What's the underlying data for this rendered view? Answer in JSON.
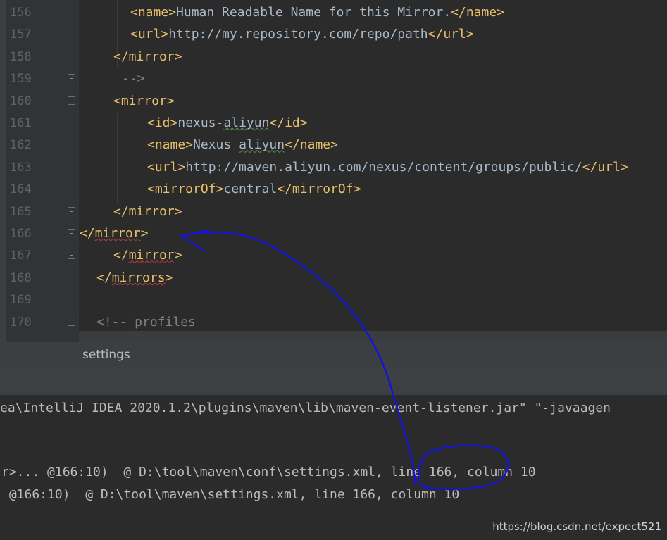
{
  "editor": {
    "lines": [
      {
        "num": "156",
        "indent": 185,
        "segments": [
          {
            "c": "tag",
            "t": "<name>"
          },
          {
            "c": "txt",
            "t": "Human Readable Name for this Mirror."
          },
          {
            "c": "tag",
            "t": "</name>"
          }
        ]
      },
      {
        "num": "157",
        "indent": 185,
        "segments": [
          {
            "c": "tag",
            "t": "<url>"
          },
          {
            "c": "link",
            "t": "http://my.repository.com/repo/path"
          },
          {
            "c": "tag",
            "t": "</url>"
          }
        ]
      },
      {
        "num": "158",
        "indent": 161,
        "segments": [
          {
            "c": "tag",
            "t": "</mirror>"
          }
        ]
      },
      {
        "num": "159",
        "indent": 173,
        "fold": true,
        "segments": [
          {
            "c": "cmt",
            "t": "-->"
          }
        ]
      },
      {
        "num": "160",
        "indent": 161,
        "fold": true,
        "segments": [
          {
            "c": "tag",
            "t": "<mirror>"
          }
        ]
      },
      {
        "num": "161",
        "indent": 209,
        "segments": [
          {
            "c": "tag",
            "t": "<id>"
          },
          {
            "c": "txt",
            "t": "nexus-"
          },
          {
            "c": "txt warn",
            "t": "aliyun"
          },
          {
            "c": "tag",
            "t": "</id>"
          }
        ]
      },
      {
        "num": "162",
        "indent": 209,
        "segments": [
          {
            "c": "tag",
            "t": "<name>"
          },
          {
            "c": "txt",
            "t": "Nexus "
          },
          {
            "c": "txt warn",
            "t": "aliyun"
          },
          {
            "c": "tag",
            "t": "</name>"
          }
        ]
      },
      {
        "num": "163",
        "indent": 209,
        "segments": [
          {
            "c": "tag",
            "t": "<url>"
          },
          {
            "c": "link",
            "t": "http://maven.aliyun.com/nexus/content/groups/public/"
          },
          {
            "c": "tag",
            "t": "</url>"
          }
        ]
      },
      {
        "num": "164",
        "indent": 209,
        "segments": [
          {
            "c": "tag",
            "t": "<mirrorOf>"
          },
          {
            "c": "txt",
            "t": "central"
          },
          {
            "c": "tag",
            "t": "</mirrorOf>"
          }
        ]
      },
      {
        "num": "165",
        "indent": 161,
        "fold": true,
        "segments": [
          {
            "c": "tag",
            "t": "</mirror>"
          }
        ]
      },
      {
        "num": "166",
        "indent": 113,
        "fold": true,
        "segments": [
          {
            "c": "tag",
            "t": "</"
          },
          {
            "c": "tag err",
            "t": "mirror"
          },
          {
            "c": "tag",
            "t": ">"
          }
        ]
      },
      {
        "num": "167",
        "indent": 161,
        "fold": true,
        "segments": [
          {
            "c": "tag",
            "t": "</"
          },
          {
            "c": "tag err",
            "t": "mirror"
          },
          {
            "c": "tag",
            "t": ">"
          }
        ]
      },
      {
        "num": "168",
        "indent": 137,
        "segments": [
          {
            "c": "tag",
            "t": "</"
          },
          {
            "c": "tag err",
            "t": "mirrors"
          },
          {
            "c": "tag",
            "t": ">"
          }
        ]
      },
      {
        "num": "169",
        "indent": 137,
        "segments": []
      },
      {
        "num": "170",
        "indent": 137,
        "fold": true,
        "segments": [
          {
            "c": "cmt",
            "t": "<!-- profiles"
          }
        ]
      }
    ]
  },
  "breadcrumb": {
    "label": "settings"
  },
  "console": {
    "lines": [
      {
        "text": "ea\\IntelliJ IDEA 2020.1.2\\plugins\\maven\\lib\\maven-event-listener.jar\" \"-javaagen"
      },
      {
        "text": ""
      },
      {
        "text": "r>... @166:10)  @ D:\\tool\\maven\\conf\\settings.xml, line 166, column 10"
      },
      {
        "text": " @166:10)  @ D:\\tool\\maven\\settings.xml, line 166, column 10"
      }
    ]
  },
  "watermark": "https://blog.csdn.net/expect521"
}
